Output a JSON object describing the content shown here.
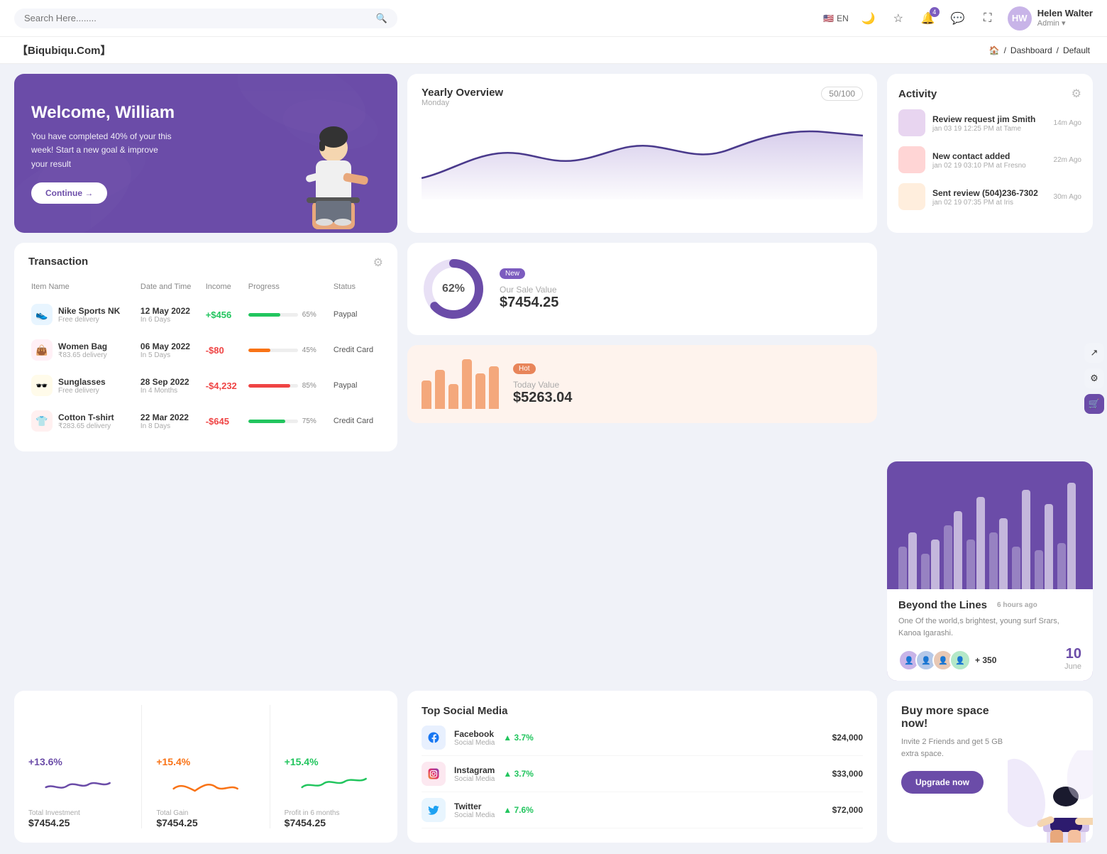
{
  "topnav": {
    "search_placeholder": "Search Here........",
    "language": "EN",
    "user": {
      "name": "Helen Walter",
      "role": "Admin",
      "initials": "HW"
    },
    "notification_count": "4"
  },
  "breadcrumb": {
    "brand": "【Biqubiqu.Com】",
    "home": "Home",
    "dashboard": "Dashboard",
    "current": "Default"
  },
  "welcome": {
    "title": "Welcome, William",
    "description": "You have completed 40% of your this week! Start a new goal & improve your result",
    "button": "Continue →"
  },
  "yearly_overview": {
    "title": "Yearly Overview",
    "subtitle": "Monday",
    "badge": "50/100"
  },
  "activity": {
    "title": "Activity",
    "items": [
      {
        "title": "Review request jim Smith",
        "subtitle": "jan 03 19 12:25 PM at Tame",
        "time": "14m Ago",
        "color": "#e8d5f0"
      },
      {
        "title": "New contact added",
        "subtitle": "jan 02 19 03:10 PM at Fresno",
        "time": "22m Ago",
        "color": "#ffd5d5"
      },
      {
        "title": "Sent review (504)236-7302",
        "subtitle": "jan 02 19 07:35 PM at Iris",
        "time": "30m Ago",
        "color": "#ffeedd"
      }
    ]
  },
  "transaction": {
    "title": "Transaction",
    "headers": [
      "Item Name",
      "Date and Time",
      "Income",
      "Progress",
      "Status"
    ],
    "rows": [
      {
        "name": "Nike Sports NK",
        "sub": "Free delivery",
        "date": "12 May 2022",
        "date_sub": "In 6 Days",
        "income": "+$456",
        "income_type": "pos",
        "progress": 65,
        "progress_color": "#22c55e",
        "status": "Paypal",
        "icon": "👟",
        "icon_bg": "#e8f5ff"
      },
      {
        "name": "Women Bag",
        "sub": "₹83.65 delivery",
        "date": "06 May 2022",
        "date_sub": "In 5 Days",
        "income": "-$80",
        "income_type": "neg",
        "progress": 45,
        "progress_color": "#f97316",
        "status": "Credit Card",
        "icon": "👜",
        "icon_bg": "#fff0f6"
      },
      {
        "name": "Sunglasses",
        "sub": "Free delivery",
        "date": "28 Sep 2022",
        "date_sub": "In 4 Months",
        "income": "-$4,232",
        "income_type": "neg",
        "progress": 85,
        "progress_color": "#ef4444",
        "status": "Paypal",
        "icon": "🕶️",
        "icon_bg": "#fffbea"
      },
      {
        "name": "Cotton T-shirt",
        "sub": "₹283.65 delivery",
        "date": "22 Mar 2022",
        "date_sub": "In 8 Days",
        "income": "-$645",
        "income_type": "neg",
        "progress": 75,
        "progress_color": "#22c55e",
        "status": "Credit Card",
        "icon": "👕",
        "icon_bg": "#fff0f0"
      }
    ]
  },
  "sale_value": {
    "badge": "New",
    "percent": "62%",
    "label": "Our Sale Value",
    "value": "$7454.25"
  },
  "today_value": {
    "badge": "Hot",
    "label": "Today Value",
    "value": "$5263.04",
    "bars": [
      40,
      55,
      35,
      70,
      50,
      60
    ]
  },
  "beyond": {
    "title": "Beyond the Lines",
    "time_ago": "6 hours ago",
    "description": "One Of the world,s brightest, young surf Srars, Kanoa Igarashi.",
    "plus_count": "+ 350",
    "date": "10",
    "date_month": "June",
    "bar_groups": [
      {
        "h1": 60,
        "h2": 80
      },
      {
        "h1": 50,
        "h2": 70
      },
      {
        "h1": 90,
        "h2": 110
      },
      {
        "h1": 70,
        "h2": 130
      },
      {
        "h1": 80,
        "h2": 100
      },
      {
        "h1": 60,
        "h2": 140
      },
      {
        "h1": 55,
        "h2": 120
      },
      {
        "h1": 65,
        "h2": 150
      }
    ]
  },
  "stats": [
    {
      "percent": "+13.6%",
      "color": "#6b4ca8",
      "label": "Total Investment",
      "value": "$7454.25"
    },
    {
      "percent": "+15.4%",
      "color": "#f97316",
      "label": "Total Gain",
      "value": "$7454.25"
    },
    {
      "percent": "+15.4%",
      "color": "#22c55e",
      "label": "Profit in 6 months",
      "value": "$7454.25"
    }
  ],
  "social_media": {
    "title": "Top Social Media",
    "items": [
      {
        "name": "Facebook",
        "type": "Social Media",
        "percent": "3.7%",
        "amount": "$24,000",
        "icon": "f",
        "icon_color": "#1877f2",
        "icon_bg": "#e8f0fe"
      },
      {
        "name": "Instagram",
        "type": "Social Media",
        "percent": "3.7%",
        "amount": "$33,000",
        "icon": "📷",
        "icon_color": "#e1306c",
        "icon_bg": "#fce8f0"
      },
      {
        "name": "Twitter",
        "type": "Social Media",
        "percent": "7.6%",
        "amount": "$72,000",
        "icon": "t",
        "icon_color": "#1da1f2",
        "icon_bg": "#e8f5fe"
      }
    ]
  },
  "buy_space": {
    "title": "Buy more space now!",
    "description": "Invite 2 Friends and get 5 GB extra space.",
    "button": "Upgrade now"
  }
}
